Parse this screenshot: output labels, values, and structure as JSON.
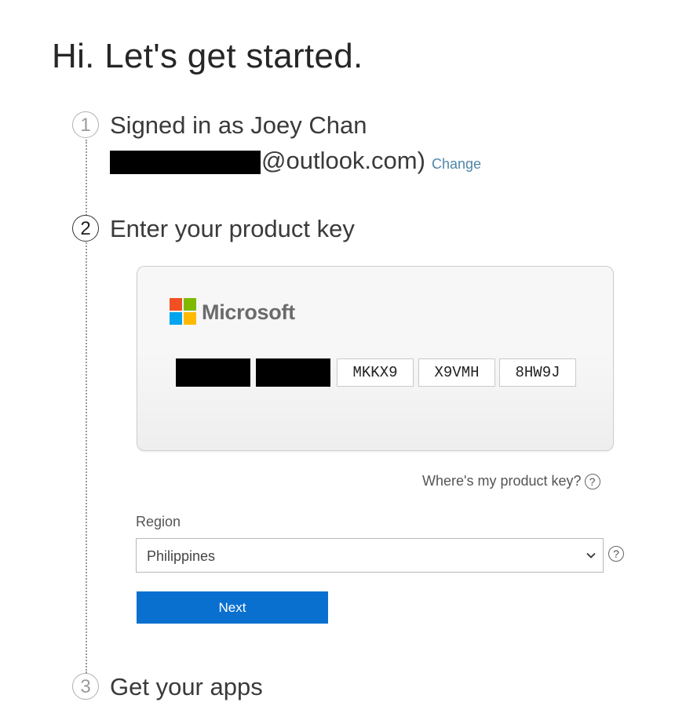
{
  "page": {
    "title": "Hi. Let's get started."
  },
  "steps": [
    {
      "number": "1",
      "title": "Signed in as Joey Chan",
      "email_suffix": "@outlook.com)",
      "change_link": "Change"
    },
    {
      "number": "2",
      "title": "Enter your product key"
    },
    {
      "number": "3",
      "title": "Get your apps"
    }
  ],
  "product_key": {
    "brand": "Microsoft",
    "segments": [
      "",
      "",
      "MKKX9",
      "X9VMH",
      "8HW9J"
    ],
    "help_text": "Where's my product key?"
  },
  "region": {
    "label": "Region",
    "selected": "Philippines"
  },
  "actions": {
    "next_label": "Next"
  },
  "colors": {
    "next_button": "#0a70d0",
    "change_link": "#4f86a8",
    "ms_red": "#f25022",
    "ms_green": "#7fba00",
    "ms_blue": "#00a4ef",
    "ms_yellow": "#ffb900"
  }
}
